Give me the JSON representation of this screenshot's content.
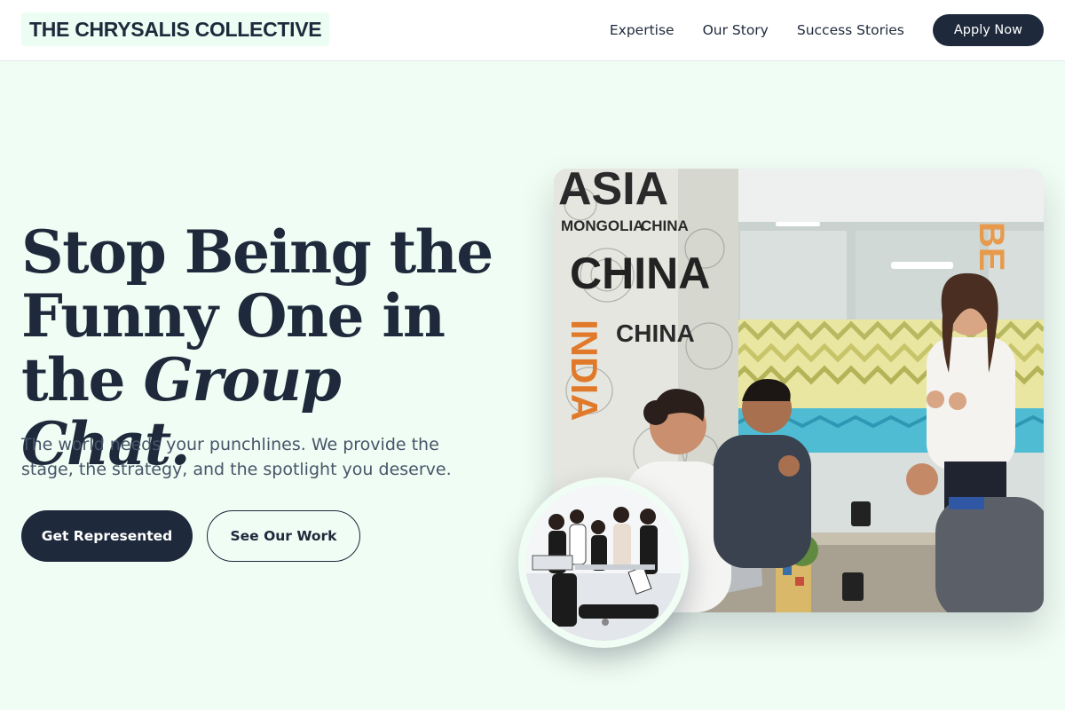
{
  "brand": {
    "name": "THE CHRYSALIS COLLECTIVE"
  },
  "nav": {
    "items": [
      "Expertise",
      "Our Story",
      "Success Stories"
    ],
    "cta": "Apply Now"
  },
  "hero": {
    "headline_line1": "Stop Being the",
    "headline_line2": "Funny One in",
    "headline_line3_plain": "the ",
    "headline_line3_italic": "Group Chat.",
    "subtext": "The world needs your punchlines. We provide the stage, the strategy, and the spotlight you deserve.",
    "primary_button": "Get Represented",
    "secondary_button": "See Our Work"
  },
  "image_wall_text": [
    "ASIA",
    "MONGOLIA",
    "CHINA",
    "INDIA"
  ],
  "colors": {
    "background": "#f0fdf4",
    "primary": "#1e293b",
    "muted": "#475569"
  }
}
